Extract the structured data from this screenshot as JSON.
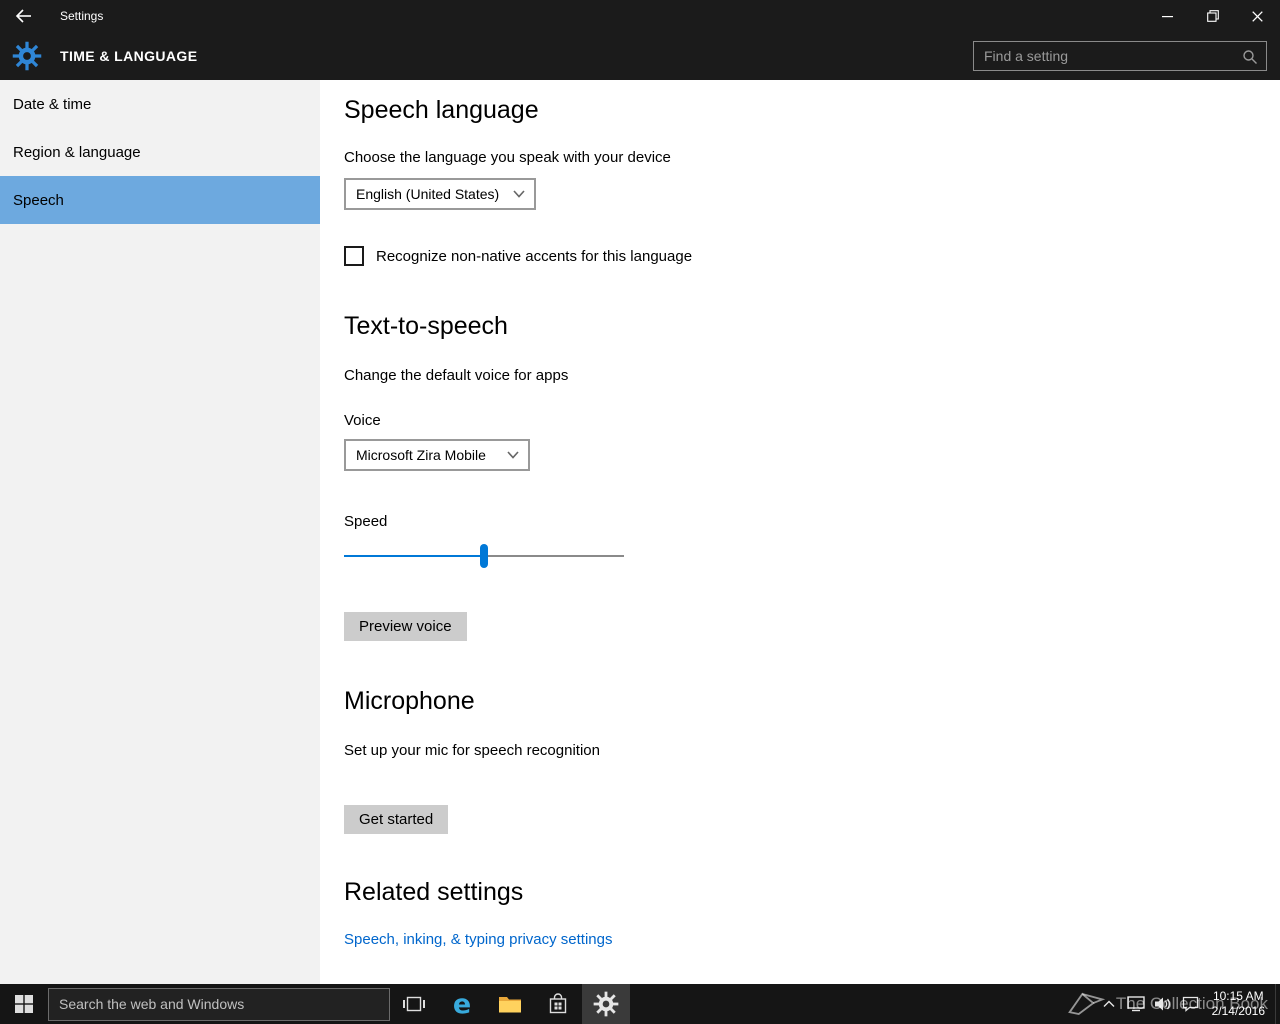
{
  "colors": {
    "accent": "#0078d7",
    "chrome_dark": "#1b1b1b",
    "sidebar_bg": "#f2f2f2",
    "sidebar_selected": "#6da9df",
    "link": "#0066cc",
    "taskbar": "#151515"
  },
  "window": {
    "title": "Settings"
  },
  "header": {
    "title": "TIME & LANGUAGE",
    "search": {
      "placeholder": "Find a setting"
    }
  },
  "sidebar": {
    "selected_index": 2,
    "items": [
      {
        "label": "Date & time"
      },
      {
        "label": "Region & language"
      },
      {
        "label": "Speech"
      }
    ]
  },
  "main": {
    "speech_language": {
      "heading": "Speech language",
      "description": "Choose the language you speak with your device",
      "language_dropdown": {
        "value": "English (United States)"
      },
      "accent_checkbox": {
        "label": "Recognize non-native accents for this language",
        "checked": false
      }
    },
    "text_to_speech": {
      "heading": "Text-to-speech",
      "description": "Change the default voice for apps",
      "voice_label": "Voice",
      "voice_dropdown": {
        "value": "Microsoft Zira Mobile"
      },
      "speed_label": "Speed",
      "speed_percent": 50,
      "preview_button_label": "Preview voice"
    },
    "microphone": {
      "heading": "Microphone",
      "description": "Set up your mic for speech recognition",
      "get_started_button_label": "Get started"
    },
    "related": {
      "heading": "Related settings",
      "privacy_link_label": "Speech, inking, & typing privacy settings"
    }
  },
  "taskbar": {
    "search": {
      "placeholder": "Search the web and Windows"
    },
    "edge_glyph": "e",
    "clock": {
      "time": "10:15 AM",
      "date": "2/14/2016"
    },
    "watermark": "The Collection Book"
  }
}
